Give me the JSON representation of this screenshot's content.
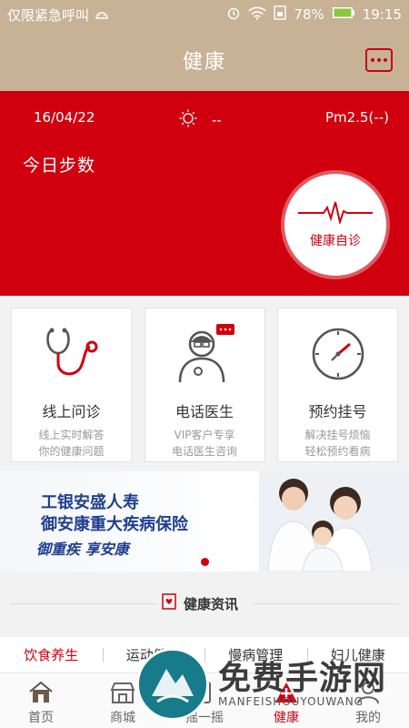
{
  "status_bar": {
    "carrier": "仅限紧急呼叫",
    "battery": "78%",
    "time": "19:15"
  },
  "header": {
    "title": "健康"
  },
  "banner": {
    "date": "16/04/22",
    "temperature": "--",
    "pm25": "Pm2.5(--)",
    "steps_label": "今日步数",
    "self_check_label": "健康自诊"
  },
  "services": [
    {
      "title": "线上问诊",
      "desc1": "线上实时解答",
      "desc2": "你的健康问题",
      "icon": "stethoscope-icon"
    },
    {
      "title": "电话医生",
      "desc1": "VIP客户专享",
      "desc2": "电话医生咨询",
      "icon": "doctor-icon"
    },
    {
      "title": "预约挂号",
      "desc1": "解决挂号烦恼",
      "desc2": "轻松预约看病",
      "icon": "clock-icon"
    }
  ],
  "ad": {
    "line1": "工银安盛人寿",
    "line2": "御安康重大疾病保险",
    "line3": "御重疾 享安康"
  },
  "news": {
    "title": "健康资讯"
  },
  "categories": [
    {
      "label": "饮食养生",
      "active": true
    },
    {
      "label": "运动健康",
      "active": false
    },
    {
      "label": "慢病管理",
      "active": false
    },
    {
      "label": "妇儿健康",
      "active": false
    }
  ],
  "bottom_nav": [
    {
      "label": "首页",
      "icon": "home-icon"
    },
    {
      "label": "商城",
      "icon": "store-icon"
    },
    {
      "label": "摇一摇",
      "icon": "shake-icon"
    },
    {
      "label": "健康",
      "icon": "health-icon",
      "active": true
    },
    {
      "label": "我的",
      "icon": "profile-icon"
    }
  ],
  "watermark": {
    "text": "免费手游网",
    "sub": "MANFEISHOUYOUWANG"
  },
  "colors": {
    "brand_red": "#d0000f",
    "header_tan": "#c7b296",
    "ad_blue": "#1f3f8f"
  }
}
